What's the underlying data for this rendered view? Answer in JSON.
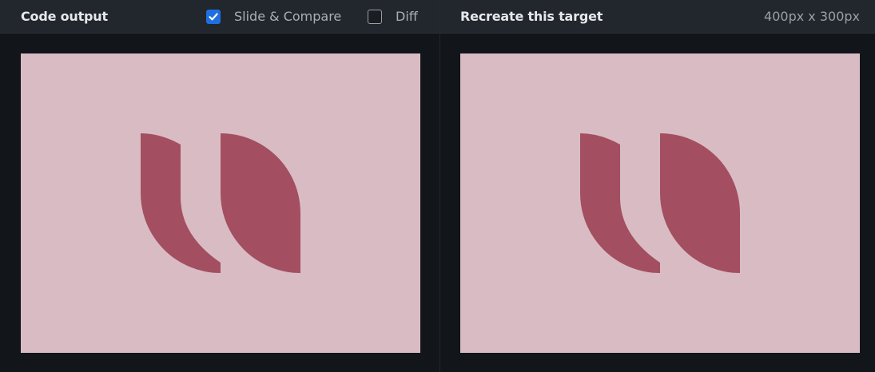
{
  "left_panel": {
    "title": "Code output",
    "slide_compare": {
      "label": "Slide & Compare",
      "checked": true
    },
    "diff": {
      "label": "Diff",
      "checked": false
    }
  },
  "right_panel": {
    "title": "Recreate this target",
    "size_readout": "400px x 300px"
  },
  "colors": {
    "background": "#121519",
    "header": "#22262d",
    "canvas": "#d9bcc3",
    "shape": "#a34f61",
    "checkbox_accent": "#1f6fe0"
  },
  "icons": {
    "checked": "check-icon",
    "shape": "quote-mark-shape"
  }
}
